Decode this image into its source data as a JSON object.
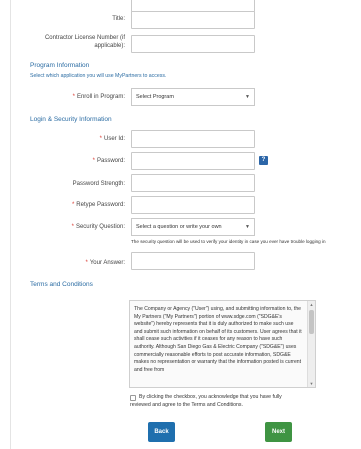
{
  "form": {
    "title_label": "Title:",
    "license_label_line1": "Contractor License Number (if",
    "license_label_line2": "applicable):"
  },
  "program": {
    "heading": "Program Information",
    "subheading": "Select which application you will use MyPartners to access.",
    "enroll_label": "Enroll in Program:",
    "enroll_value": "Select Program"
  },
  "login": {
    "heading": "Login & Security Information",
    "userid_label": "User Id:",
    "password_label": "Password:",
    "help_glyph": "?",
    "strength_label": "Password Strength:",
    "retype_label": "Retype Password:",
    "question_label": "Security Question:",
    "question_value": "Select a question or write your own",
    "question_note": "The security question will be used to verify your identity in case you ever have trouble logging in",
    "answer_label": "Your Answer:"
  },
  "required_mark": "*",
  "caret": "▼",
  "terms": {
    "heading": "Terms and Conditions",
    "body": "The Company or Agency (\"User\") using, and submitting information to, the My Partners (\"My Partners\") portion of www.sdge.com (\"SDG&E's website\") hereby represents that it is duly authorized to make such use and submit such information on behalf of its customers. User agrees that it shall cease such activities if it ceases for any reason to have such authority. Although San Diego Gas & Electric Company (\"SDG&E\") uses commercially reasonable efforts to post accurate information, SDG&E makes no representation or warranty that the information posted is current and free from",
    "scroll_up": "▲",
    "scroll_down": "▼",
    "ack_line1": "By clicking the checkbox, you acknowledge that you have fully",
    "ack_line2": "reviewed and agree to the Terms and Conditions."
  },
  "buttons": {
    "back": "Back",
    "next": "Next"
  },
  "colors": {
    "section_blue": "#2b6ca3",
    "required_red": "#d9342b",
    "back_button": "#1f6fae",
    "next_button": "#3f9443"
  }
}
